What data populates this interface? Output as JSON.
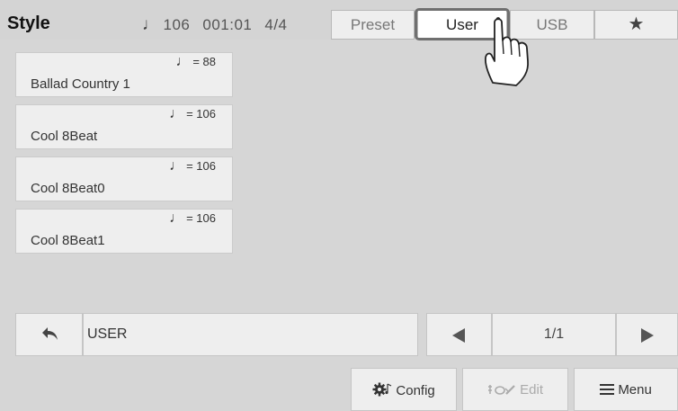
{
  "header": {
    "title": "Style",
    "tempo": "106",
    "measure": "001:01",
    "time_signature": "4/4",
    "note_icon": "quarter-note-icon"
  },
  "tabs": [
    {
      "label": "Preset",
      "active": false
    },
    {
      "label": "User",
      "active": true
    },
    {
      "label": "USB",
      "active": false
    },
    {
      "label": "",
      "icon": "star-icon",
      "active": false
    }
  ],
  "styles": [
    {
      "name": "Ballad Country 1",
      "tempo": "= 88"
    },
    {
      "name": "Cool 8Beat",
      "tempo": "= 106"
    },
    {
      "name": "Cool 8Beat0",
      "tempo": "= 106"
    },
    {
      "name": "Cool 8Beat1",
      "tempo": "= 106"
    }
  ],
  "path": {
    "label": "USER",
    "back_icon": "back-arrow-icon"
  },
  "pagination": {
    "page": "1/1",
    "prev_icon": "triangle-left-icon",
    "next_icon": "triangle-right-icon"
  },
  "footer": {
    "config_label": "Config",
    "edit_label": "Edit",
    "menu_label": "Menu"
  },
  "colors": {
    "background": "#d6d6d6",
    "tab_active": "#ffffff",
    "selection_frame": "#6f6f6f"
  }
}
